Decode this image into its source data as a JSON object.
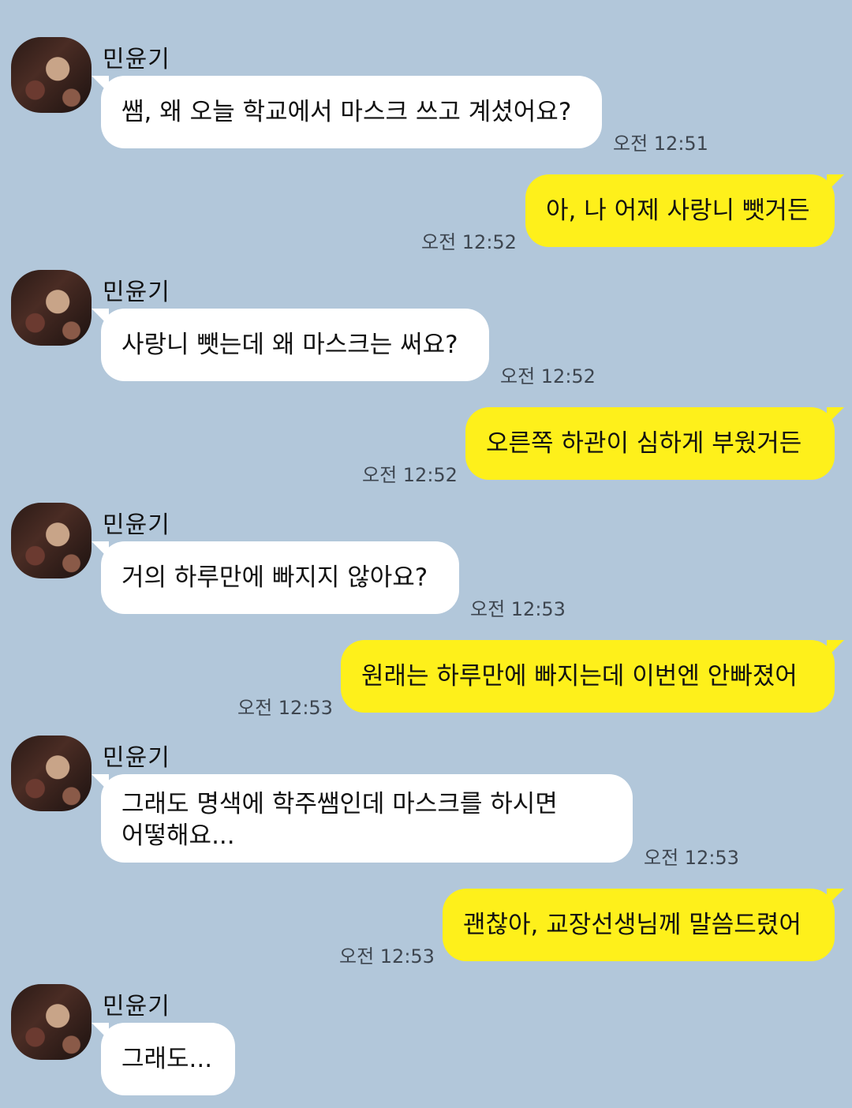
{
  "chat": {
    "sender_name": "민윤기",
    "messages": [
      {
        "text": "쌤, 왜 오늘 학교에서 마스크 쓰고 계셨어요?",
        "time": "오전 12:51"
      },
      {
        "text": "아, 나 어제 사랑니 뺏거든",
        "time": "오전 12:52"
      },
      {
        "text": "사랑니 뺏는데 왜 마스크는 써요?",
        "time": "오전 12:52"
      },
      {
        "text": "오른쪽 하관이 심하게 부웠거든",
        "time": "오전 12:52"
      },
      {
        "text": "거의 하루만에 빠지지 않아요?",
        "time": "오전 12:53"
      },
      {
        "text": "원래는 하루만에 빠지는데 이번엔 안빠졌어",
        "time": "오전 12:53"
      },
      {
        "text_line1": "그래도 명색에 학주쌤인데 마스크를 하시면",
        "text_line2": "어떻해요...",
        "time": "오전 12:53"
      },
      {
        "text": "괜찮아, 교장선생님께 말씀드렸어",
        "time": "오전 12:53"
      },
      {
        "text": "그래도..."
      }
    ]
  },
  "colors": {
    "background": "#b2c7da",
    "incoming_bubble": "#ffffff",
    "outgoing_bubble": "#fef01b"
  }
}
